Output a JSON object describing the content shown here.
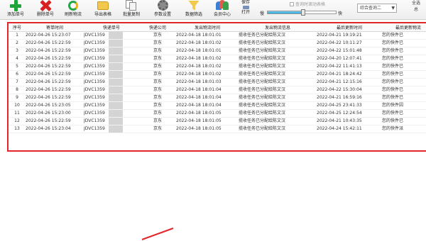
{
  "toolbar": {
    "buttons": [
      {
        "label": "添加单号",
        "icon": "plus-icon"
      },
      {
        "label": "删除单号",
        "icon": "delete-icon"
      },
      {
        "label": "刷新物流",
        "icon": "refresh-icon"
      },
      {
        "label": "导出表格",
        "icon": "folder-icon"
      },
      {
        "label": "批量复制",
        "icon": "copy-icon"
      },
      {
        "label": "参数设置",
        "icon": "gear-icon"
      },
      {
        "label": "数据筛选",
        "icon": "filter-icon"
      },
      {
        "label": "会员中心",
        "icon": "members-icon"
      }
    ],
    "save_label": "保存",
    "open_label": "打开",
    "slow_label": "慢",
    "fast_label": "快",
    "speed_level": 0.52,
    "scroll_checkbox_label": "查询时滚动表格",
    "scroll_checked": false,
    "query_select_value": "综合查询二",
    "select_all_label": "全选",
    "other_label": "总"
  },
  "grid": {
    "columns": [
      "序号",
      "寄单时间",
      "快递单号",
      "快递公司",
      "发出物流时间",
      "发出物流信息",
      "最后更新时间",
      "最后更新物流"
    ],
    "rows": [
      [
        "1",
        "2022-04-26 15:23:07",
        "JDVC1359",
        "京东",
        "2022-04-18 18:01:01",
        "揽收任务已分配给陈文汉",
        "2022-04-21 19:19:21",
        "您的快件已"
      ],
      [
        "2",
        "2022-04-26 15:22:59",
        "JDVC1359",
        "京东",
        "2022-04-18 18:01:02",
        "揽收任务已分配给陈文汉",
        "2022-04-22 10:11:27",
        "您的快件已"
      ],
      [
        "3",
        "2022-04-26 15:22:59",
        "JDVC1359",
        "京东",
        "2022-04-18 18:01:01",
        "揽收任务已分配给陈文汉",
        "2022-04-22 15:01:48",
        "您的快件已"
      ],
      [
        "4",
        "2022-04-26 15:22:59",
        "JDVC1359",
        "京东",
        "2022-04-18 18:01:02",
        "揽收任务已分配给陈文汉",
        "2022-04-20 12:07:41",
        "您的快件已"
      ],
      [
        "5",
        "2022-04-26 15:22:59",
        "JDVC1359",
        "京东",
        "2022-04-18 18:01:02",
        "揽收任务已分配给陈文汉",
        "2022-04-22 11:41:13",
        "您的快件已"
      ],
      [
        "6",
        "2022-04-26 15:22:59",
        "JDVC1359",
        "京东",
        "2022-04-18 18:01:02",
        "揽收任务已分配给陈文汉",
        "2022-04-21 18:24:42",
        "您的快件已"
      ],
      [
        "7",
        "2022-04-26 15:22:59",
        "JDVC1359",
        "京东",
        "2022-04-18 18:01:03",
        "揽收任务已分配给陈文汉",
        "2022-04-21 12:15:16",
        "您的快件已"
      ],
      [
        "8",
        "2022-04-26 15:22:59",
        "JDVC1359",
        "京东",
        "2022-04-18 18:01:04",
        "揽收任务已分配给陈文汉",
        "2022-04-22 15:30:04",
        "您的快件已"
      ],
      [
        "9",
        "2022-04-26 15:22:59",
        "JDVC1359",
        "京东",
        "2022-04-18 18:01:04",
        "揽收任务已分配给陈文汉",
        "2022-04-21 16:59:16",
        "您的快件已"
      ],
      [
        "10",
        "2022-04-26 15:23:05",
        "JDVC1359",
        "京东",
        "2022-04-18 18:01:04",
        "揽收任务已分配给陈文汉",
        "2022-04-25 23:41:33",
        "您的快件因"
      ],
      [
        "11",
        "2022-04-26 15:23:00",
        "JDVC1359",
        "京东",
        "2022-04-18 18:01:05",
        "揽收任务已分配给陈文汉",
        "2022-04-25 12:24:54",
        "您的快件已"
      ],
      [
        "12",
        "2022-04-26 15:22:59",
        "JDVC1359",
        "京东",
        "2022-04-18 18:01:05",
        "揽收任务已分配给陈文汉",
        "2022-04-21 10:43:35",
        "您的快件已"
      ],
      [
        "13",
        "2022-04-26 15:23:04",
        "JDVC1359",
        "京东",
        "2022-04-18 18:01:05",
        "揽收任务已分配给陈文汉",
        "2022-04-24 15:42:11",
        "您的快件派"
      ]
    ]
  },
  "colors": {
    "highlight_border": "#e2262c",
    "slider_fill": "#26a3d6"
  }
}
